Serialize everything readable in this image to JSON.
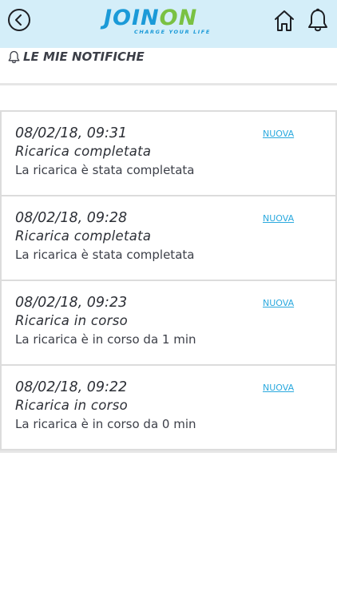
{
  "header": {
    "logo": {
      "main_left": "JOIN",
      "main_right": "ON",
      "tagline": "CHARGE YOUR LIFE"
    },
    "icons": {
      "back": "back-icon",
      "home": "home-icon",
      "bell": "bell-icon"
    },
    "background_color": "#d4eef9"
  },
  "page": {
    "title": "LE MIE NOTIFICHE",
    "title_icon": "bell-icon"
  },
  "notifications": [
    {
      "date": "08/02/18, 09:31",
      "title": "Ricarica completata",
      "description": "La ricarica è stata completata",
      "badge": "NUOVA"
    },
    {
      "date": "08/02/18, 09:28",
      "title": "Ricarica completata",
      "description": "La ricarica è stata completata",
      "badge": "NUOVA"
    },
    {
      "date": "08/02/18, 09:23",
      "title": "Ricarica in corso",
      "description": "La ricarica è in corso da 1 min",
      "badge": "NUOVA"
    },
    {
      "date": "08/02/18, 09:22",
      "title": "Ricarica in corso",
      "description": "La ricarica è in corso da 0 min",
      "badge": "NUOVA"
    }
  ],
  "colors": {
    "brand_blue": "#1b9ad8",
    "brand_green": "#7ac143",
    "link": "#2ba9de",
    "text": "#2c2f36"
  }
}
